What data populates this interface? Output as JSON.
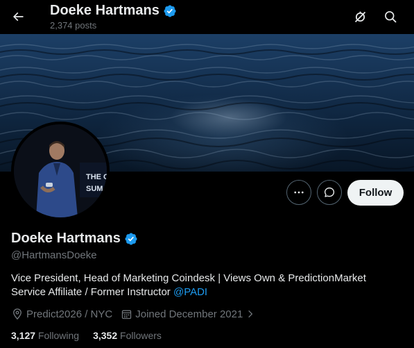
{
  "header": {
    "title": "Doeke Hartmans",
    "post_count": "2,374 posts",
    "back_icon": "arrow-left-icon",
    "actions": [
      {
        "icon": "notifications-off-icon"
      },
      {
        "icon": "search-icon"
      }
    ]
  },
  "banner": {
    "description_icon": "ocean-banner-image"
  },
  "avatar": {
    "overlay_text_line1": "THE C",
    "overlay_text_line2": "SUM"
  },
  "profile_actions": {
    "more_icon": "more-dots-icon",
    "message_icon": "message-bubble-icon",
    "follow_label": "Follow"
  },
  "profile": {
    "name": "Doeke Hartmans",
    "verified": true,
    "handle": "@HartmansDoeke",
    "bio_text": "Vice President, Head of Marketing Coindesk | Views Own & PredictionMarket Service Affiliate / Former Instructor ",
    "bio_mention": "@PADI",
    "location": "Predict2026 / NYC",
    "joined": "Joined December 2021",
    "following_count": "3,127",
    "following_label": "Following",
    "followers_count": "3,352",
    "followers_label": "Followers"
  },
  "colors": {
    "background": "#000000",
    "accent": "#1d9bf0",
    "verified": "#1d9bf0",
    "secondary_text": "#71767b",
    "follow_button": "#eff3f4"
  }
}
